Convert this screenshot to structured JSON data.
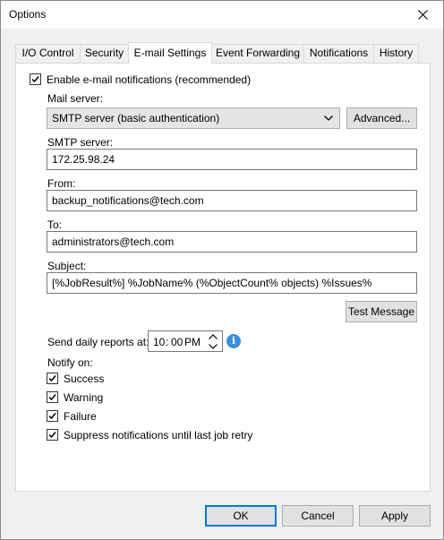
{
  "window": {
    "title": "Options"
  },
  "tabs": [
    {
      "label": "I/O Control",
      "active": false
    },
    {
      "label": "Security",
      "active": false
    },
    {
      "label": "E-mail Settings",
      "active": true
    },
    {
      "label": "Event Forwarding",
      "active": false
    },
    {
      "label": "Notifications",
      "active": false
    },
    {
      "label": "History",
      "active": false
    }
  ],
  "email": {
    "enable_label": "Enable e-mail notifications (recommended)",
    "enable_checked": true,
    "mail_server_label": "Mail server:",
    "mail_server_value": "SMTP server (basic authentication)",
    "advanced_label": "Advanced...",
    "smtp_label": "SMTP server:",
    "smtp_value": "172.25.98.24",
    "from_label": "From:",
    "from_value": "backup_notifications@tech.com",
    "to_label": "To:",
    "to_value": "administrators@tech.com",
    "subject_label": "Subject:",
    "subject_value": "[%JobResult%] %JobName% (%ObjectCount% objects) %Issues%",
    "test_label": "Test Message",
    "daily_label": "Send daily reports at:",
    "daily_hour": "10",
    "daily_sep": ":",
    "daily_minute": "00",
    "daily_ampm": "PM",
    "info_glyph": "i",
    "notify_label": "Notify on:",
    "notify_items": [
      {
        "label": "Success",
        "checked": true
      },
      {
        "label": "Warning",
        "checked": true
      },
      {
        "label": "Failure",
        "checked": true
      },
      {
        "label": "Suppress notifications until last job retry",
        "checked": true
      }
    ]
  },
  "buttons": {
    "ok": "OK",
    "cancel": "Cancel",
    "apply": "Apply"
  },
  "colors": {
    "accent": "#0078d7",
    "info": "#3c8fd8",
    "panel_bg": "#ffffff",
    "window_bg": "#f0f0f0"
  }
}
